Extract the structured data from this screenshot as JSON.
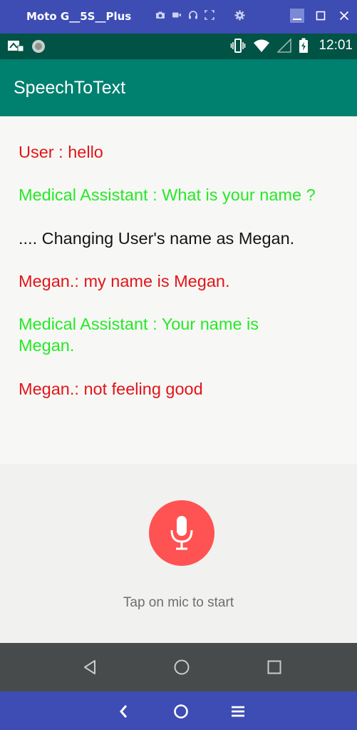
{
  "window": {
    "title": "Moto G__5S__Plus",
    "tools": [
      "camera-icon",
      "video-icon",
      "headset-icon",
      "fullscreen-icon"
    ],
    "settings_icon": "gear-icon",
    "controls": [
      "minimize-icon",
      "maximize-icon",
      "close-icon"
    ]
  },
  "status_bar": {
    "time": "12:01",
    "icons": [
      "screencast-icon",
      "circle-app-icon",
      "vibrate-icon",
      "wifi-icon",
      "signal-icon",
      "battery-charging-icon"
    ]
  },
  "app_bar": {
    "title": "SpeechToText",
    "color": "#00806f"
  },
  "conversation": {
    "messages": [
      {
        "text": "User : hello",
        "color": "#e3141a"
      },
      {
        "text": "Medical Assistant : What is your name ?",
        "color": "#27e827"
      },
      {
        "text": ".... Changing User's name as Megan.",
        "color": "#141414"
      },
      {
        "text": "Megan.: my name is Megan.",
        "color": "#e3141a"
      },
      {
        "text": "Medical Assistant : Your name is Megan.",
        "color": "#27e827"
      },
      {
        "text": "Megan.: not feeling good",
        "color": "#e3141a"
      }
    ]
  },
  "mic": {
    "icon": "microphone-icon",
    "hint": "Tap on mic to start",
    "color": "#ff5252"
  },
  "android_nav": [
    "back-icon",
    "home-icon",
    "recents-icon"
  ],
  "emulator_nav": [
    "chevron-left-icon",
    "home-circle-icon",
    "menu-icon"
  ]
}
